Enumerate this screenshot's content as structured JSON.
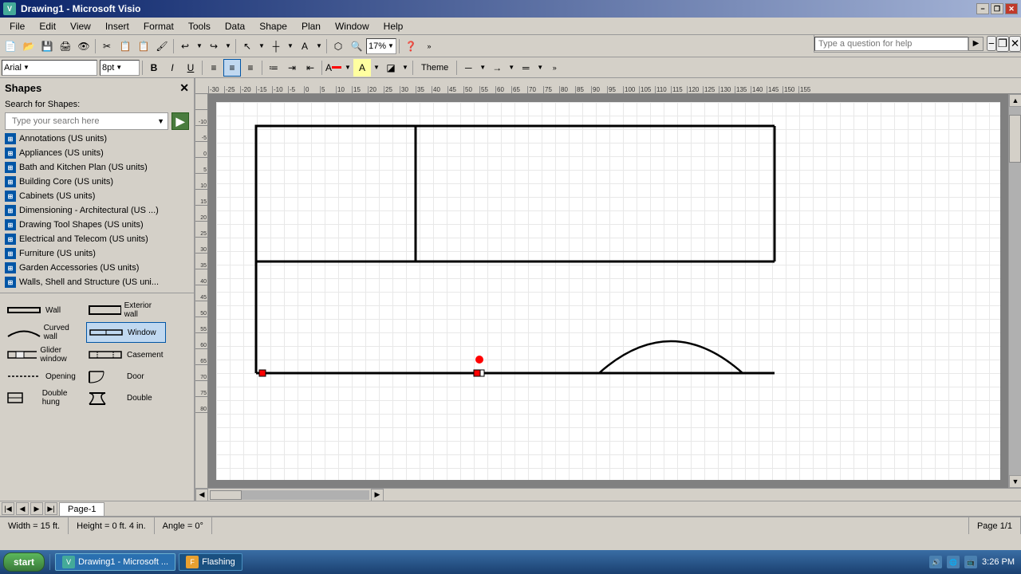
{
  "titlebar": {
    "title": "Drawing1 - Microsoft Visio",
    "icon_label": "V",
    "btn_minimize": "−",
    "btn_restore": "❐",
    "btn_close": "✕"
  },
  "menubar": {
    "items": [
      "File",
      "Edit",
      "View",
      "Insert",
      "Format",
      "Tools",
      "Data",
      "Shape",
      "Plan",
      "Window",
      "Help"
    ]
  },
  "help": {
    "placeholder": "Type a question for help",
    "btn_label": "▶"
  },
  "toolbar1": {
    "zoom_label": "17%",
    "buttons": [
      "📄",
      "📂",
      "💾",
      "🖨",
      "👁",
      "✂",
      "📋",
      "🔄",
      "↩",
      "↪",
      "🔲",
      "↕",
      "⬡",
      "🔤",
      "🔍",
      "❓"
    ]
  },
  "toolbar2": {
    "font_name": "Arial",
    "font_size": "8pt",
    "theme_label": "Theme",
    "bold": "B",
    "italic": "I",
    "underline": "U"
  },
  "sidebar": {
    "title": "Shapes",
    "search_label": "Search for Shapes:",
    "search_placeholder": "Type your search here",
    "search_btn": "▶",
    "categories": [
      "Annotations (US units)",
      "Appliances (US units)",
      "Bath and Kitchen Plan (US units)",
      "Building Core (US units)",
      "Cabinets (US units)",
      "Dimensioning - Architectural (US ...)",
      "Drawing Tool Shapes (US units)",
      "Electrical and Telecom (US units)",
      "Furniture (US units)",
      "Garden Accessories (US units)",
      "Walls, Shell and Structure (US uni..."
    ],
    "shapes": [
      {
        "label": "Wall",
        "type": "wall"
      },
      {
        "label": "Exterior wall",
        "type": "ext-wall"
      },
      {
        "label": "Curved wall",
        "type": "curved-wall"
      },
      {
        "label": "Window",
        "type": "window"
      },
      {
        "label": "Glider window",
        "type": "glider"
      },
      {
        "label": "Casement",
        "type": "casement"
      },
      {
        "label": "Opening",
        "type": "opening"
      },
      {
        "label": "Door",
        "type": "door"
      },
      {
        "label": "Double hung",
        "type": "double-hung"
      },
      {
        "label": "Double",
        "type": "double"
      }
    ]
  },
  "status": {
    "width": "Width = 15 ft.",
    "height": "Height = 0 ft. 4 in.",
    "angle": "Angle = 0°",
    "page": "Page 1/1"
  },
  "page_tab": {
    "label": "Page-1"
  },
  "taskbar": {
    "start_label": "start",
    "items": [
      {
        "label": "Drawing1 - Microsoft ...",
        "icon": "V"
      },
      {
        "label": "Flashing",
        "icon": "F"
      }
    ],
    "time": "3:26 PM"
  }
}
